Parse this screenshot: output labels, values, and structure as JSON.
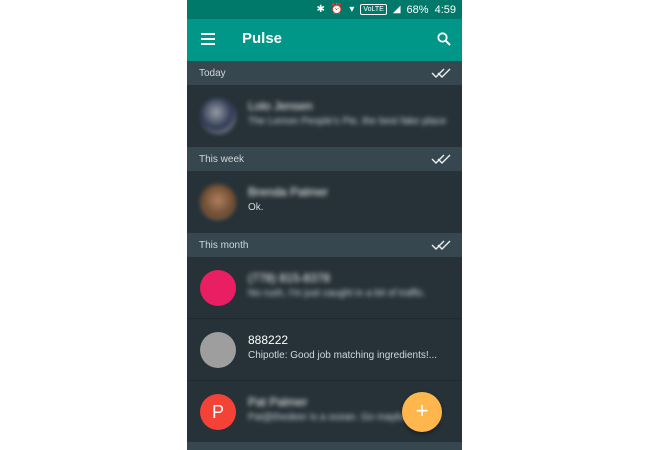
{
  "status_bar": {
    "network_badge": "VoLTE",
    "battery": "68%",
    "time": "4:59"
  },
  "app_bar": {
    "title": "Pulse"
  },
  "sections": [
    {
      "label": "Today"
    },
    {
      "label": "This week"
    },
    {
      "label": "This month"
    }
  ],
  "conversations": [
    {
      "name": "Lolo Jensen",
      "snippet": "The Lemon People's Pie, the best fake place",
      "avatar": "photo"
    },
    {
      "name": "Brenda Palmer",
      "snippet": "Ok.",
      "avatar": "photo"
    },
    {
      "name": "(778) 815-8378",
      "snippet": "No rush, I'm just caught in a bit of traffic.",
      "avatar_color": "#e91e63"
    },
    {
      "name": "888222",
      "snippet": "Chipotle: Good job matching ingredients!...",
      "avatar_color": "#9e9e9e"
    },
    {
      "name": "Pat Palmer",
      "snippet": "Pat@thedeer is a ocean. Go maybe a while",
      "avatar_letter": "P",
      "avatar_color": "#f44336"
    }
  ],
  "fab": {
    "label": "+"
  },
  "colors": {
    "primary": "#009688",
    "primary_dark": "#00796b",
    "accent": "#ffb74d",
    "background": "#263238",
    "section": "#37474f"
  }
}
